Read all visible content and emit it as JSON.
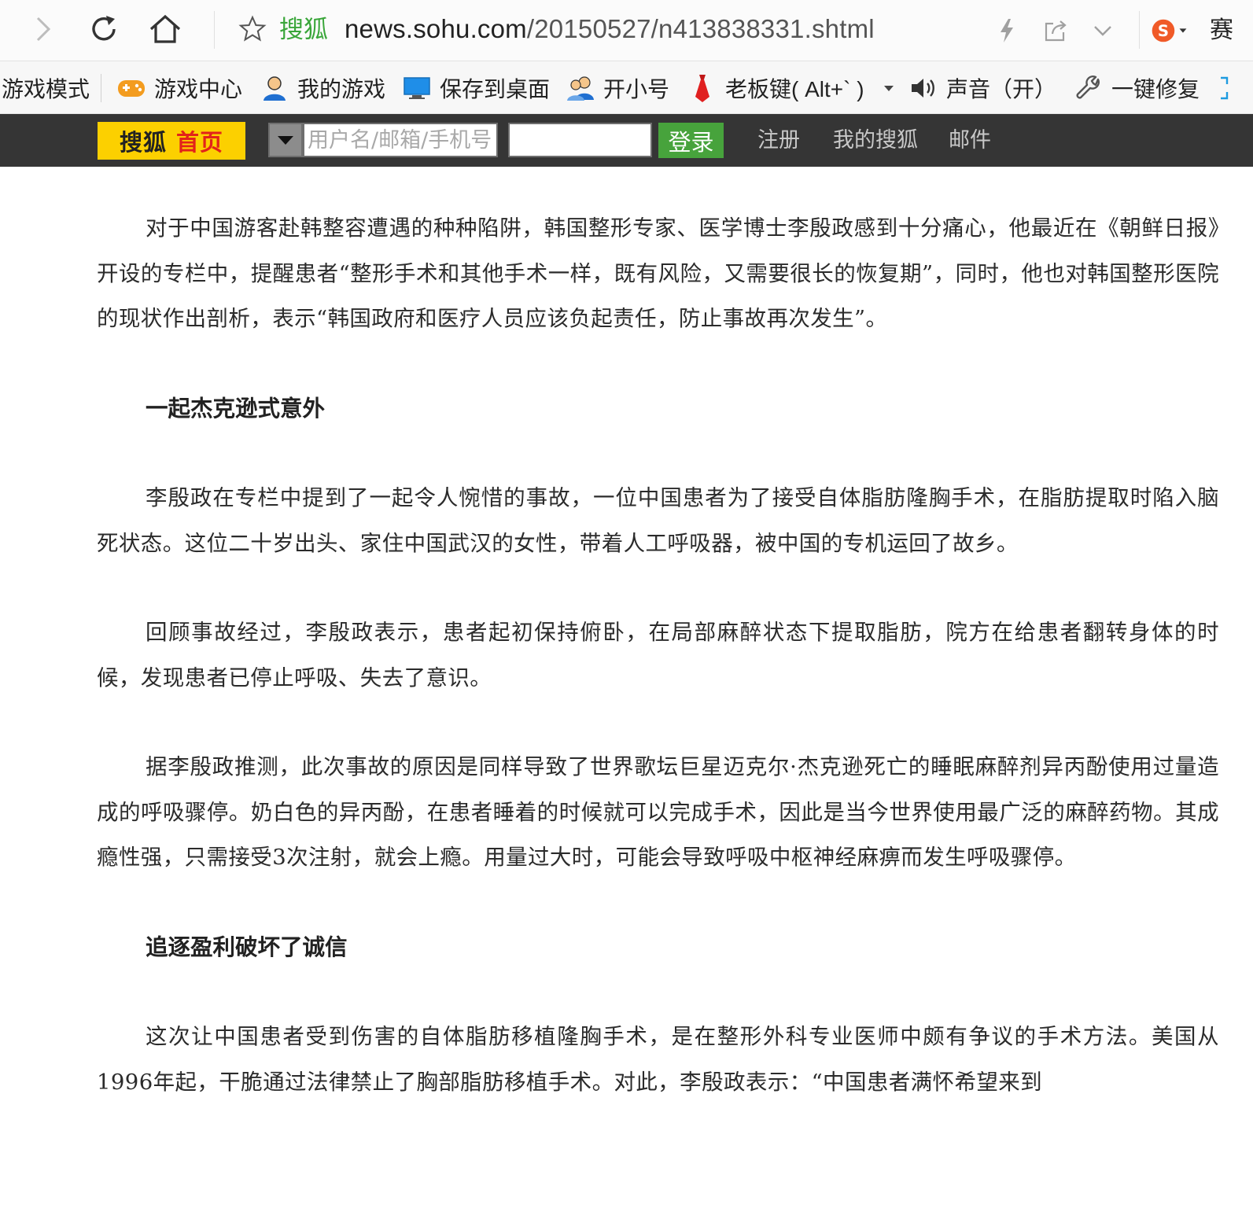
{
  "browser": {
    "site_name": "搜狐",
    "url_host": "news.sohu.com",
    "url_path": "/20150527/n413838331.shtml",
    "extra_char": "赛",
    "icons": [
      "back-icon",
      "reload-icon",
      "home-icon",
      "star-icon",
      "lightning-icon",
      "share-icon",
      "chevron-down-icon",
      "sogou-s-icon"
    ]
  },
  "toolbar": {
    "items": [
      {
        "label": "游戏模式"
      },
      {
        "label": "游戏中心",
        "icon": "gamepad-icon"
      },
      {
        "label": "我的游戏",
        "icon": "user-icon"
      },
      {
        "label": "保存到桌面",
        "icon": "monitor-icon"
      },
      {
        "label": "开小号",
        "icon": "users-icon"
      },
      {
        "label": "老板键( Alt+` )",
        "icon": "tie-icon"
      },
      {
        "label": "声音（开）",
        "icon": "speaker-icon"
      },
      {
        "label": "一键修复",
        "icon": "wrench-icon"
      }
    ]
  },
  "sohu_bar": {
    "home_sohu": "搜狐",
    "home_label": "首页",
    "username_placeholder": "用户名/邮箱/手机号",
    "login_label": "登录",
    "links": [
      "注册",
      "我的搜狐",
      "邮件"
    ]
  },
  "article": {
    "p1": "对于中国游客赴韩整容遭遇的种种陷阱，韩国整形专家、医学博士李殷政感到十分痛心，他最近在《朝鲜日报》　开设的专栏中，提醒患者“整形手术和其他手术一样，既有风险，又需要很长的恢复期”，同时，他也对韩国整形医院的现状作出剖析，表示“韩国政府和医疗人员应该负起责任，防止事故再次发生”。",
    "h1": "一起杰克逊式意外",
    "p2": "李殷政在专栏中提到了一起令人惋惜的事故，一位中国患者为了接受自体脂肪隆胸手术，在脂肪提取时陷入脑死状态。这位二十岁出头、家住中国武汉的女性，带着人工呼吸器，被中国的专机运回了故乡。",
    "p3": "回顾事故经过，李殷政表示，患者起初保持俯卧，在局部麻醉状态下提取脂肪，院方在给患者翻转身体的时候，发现患者已停止呼吸、失去了意识。",
    "p4": "据李殷政推测，此次事故的原因是同样导致了世界歌坛巨星迈克尔·杰克逊死亡的睡眠麻醉剂异丙酚使用过量造成的呼吸骤停。奶白色的异丙酚，在患者睡着的时候就可以完成手术，因此是当今世界使用最广泛的麻醉药物。其成瘾性强，只需接受3次注射，就会上瘾。用量过大时，可能会导致呼吸中枢神经麻痹而发生呼吸骤停。",
    "h2": "追逐盈利破坏了诚信",
    "p5": "这次让中国患者受到伤害的自体脂肪移植隆胸手术，是在整形外科专业医师中颇有争议的手术方法。美国从1996年起，干脆通过法律禁止了胸部脂肪移植手术。对此，李殷政表示：“中国患者满怀希望来到"
  }
}
